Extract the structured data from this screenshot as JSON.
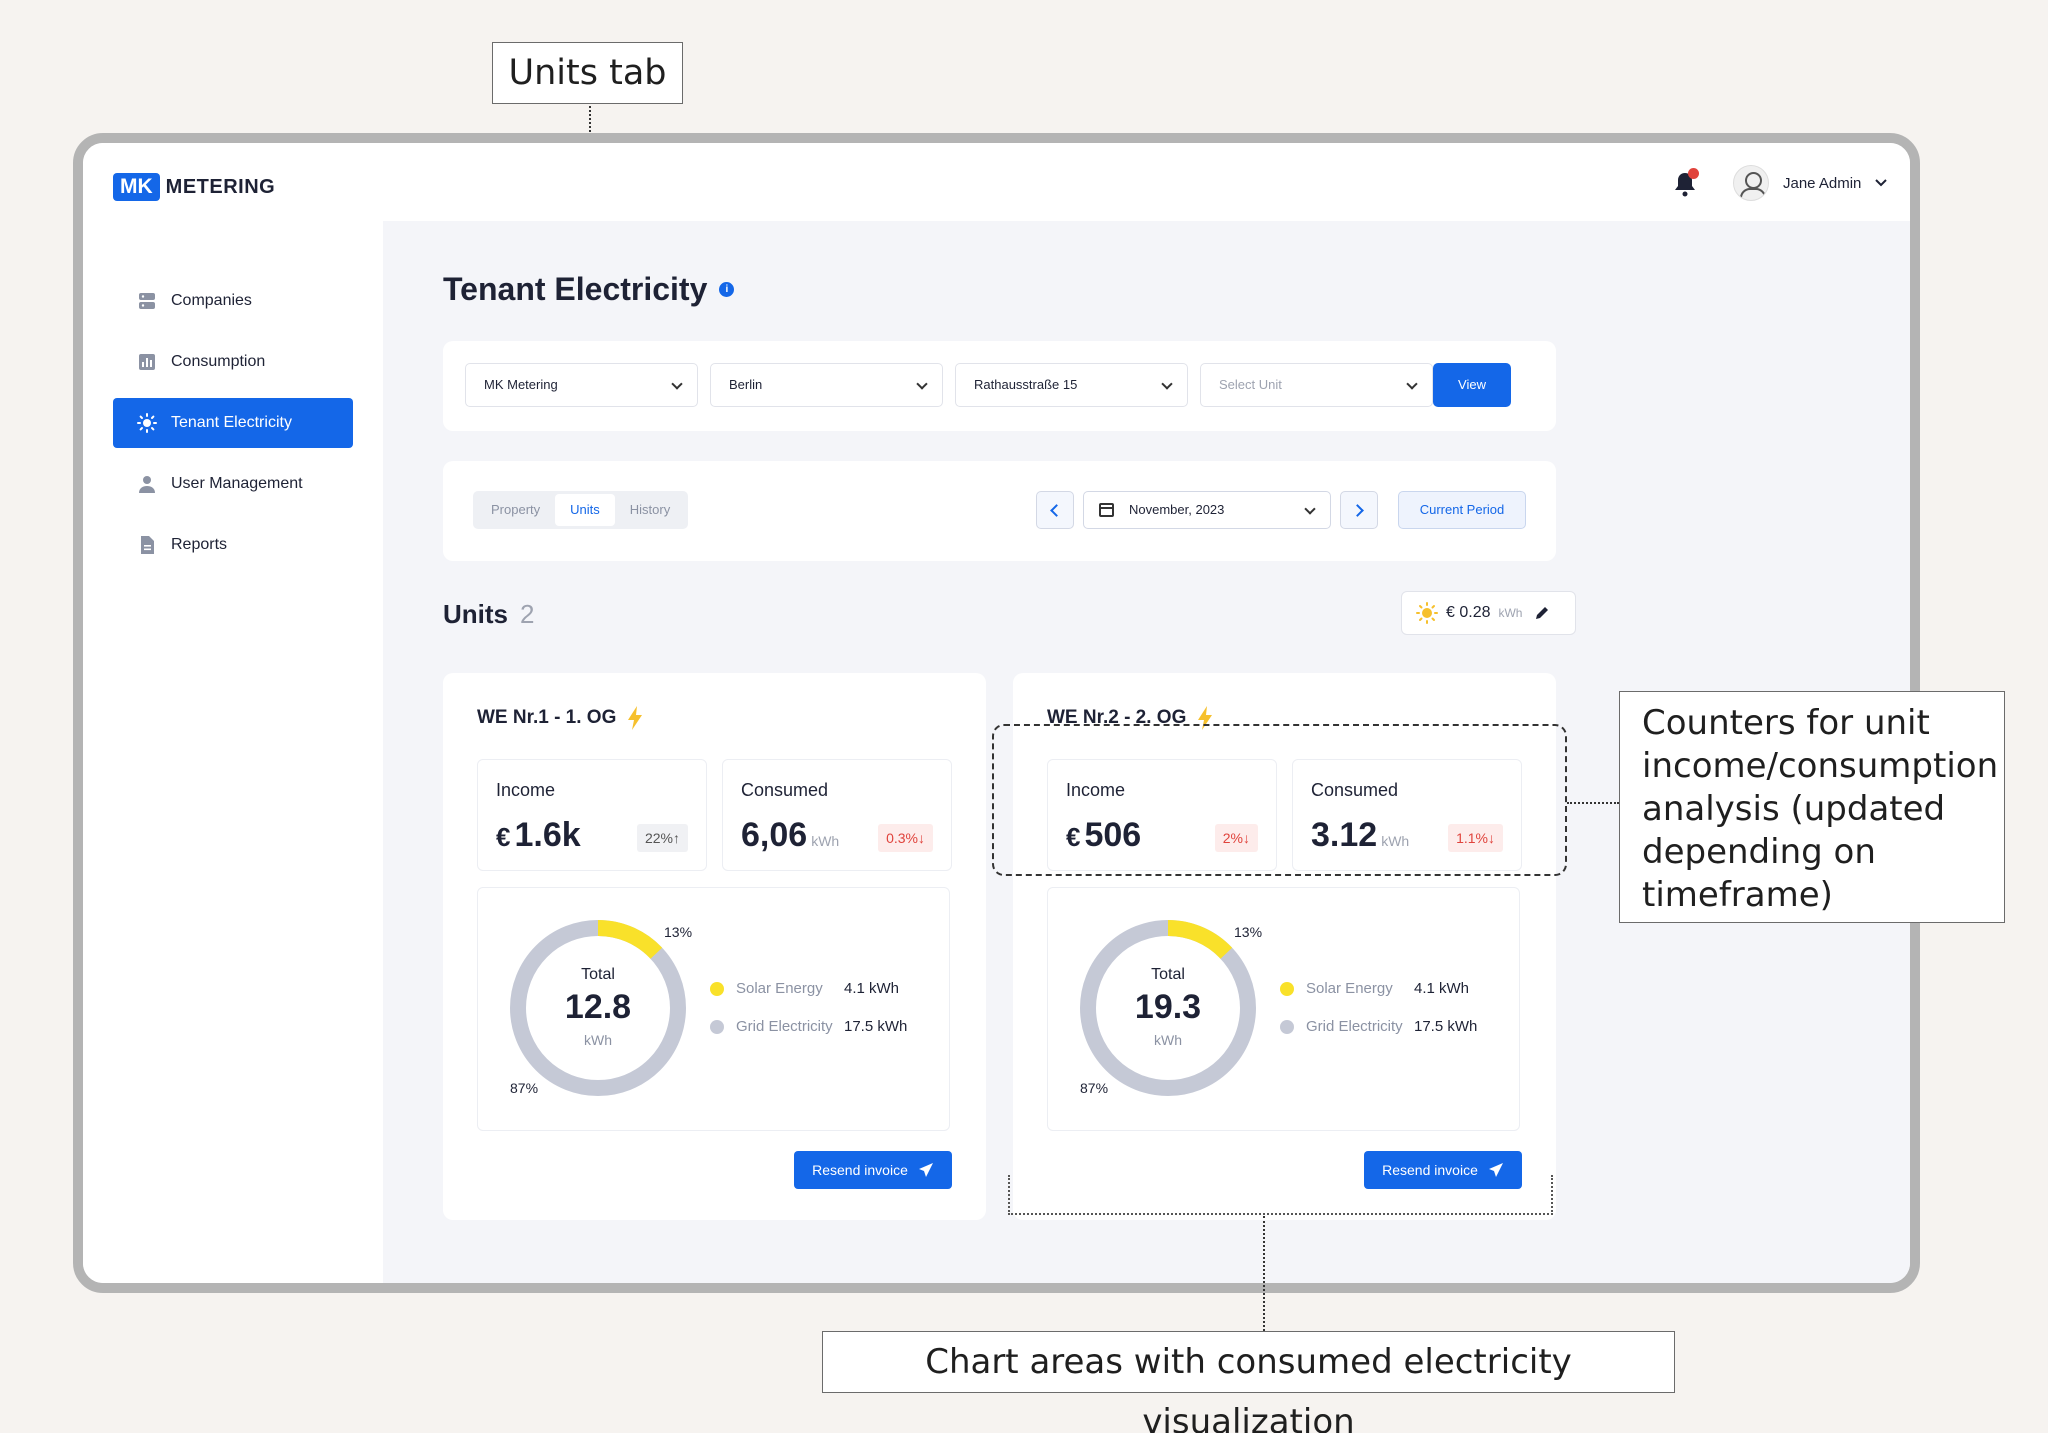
{
  "annotations": {
    "units_tab": "Units tab",
    "counters": "Counters for unit income/consumption analysis (updated depending on timeframe)",
    "charts": "Chart areas with consumed electricity visualization"
  },
  "header": {
    "logo_mk": "MK",
    "logo_text": "METERING",
    "user_name": "Jane Admin",
    "notification_color": "#e0433c"
  },
  "sidebar": {
    "items": [
      {
        "label": "Companies",
        "icon": "server-icon"
      },
      {
        "label": "Consumption",
        "icon": "bar-chart-icon"
      },
      {
        "label": "Tenant Electricity",
        "icon": "sun-icon",
        "active": true
      },
      {
        "label": "User Management",
        "icon": "user-icon"
      },
      {
        "label": "Reports",
        "icon": "document-icon"
      }
    ]
  },
  "page": {
    "title": "Tenant Electricity",
    "info_icon": "i"
  },
  "filters": {
    "company": "MK Metering",
    "city": "Berlin",
    "address": "Rathausstraße 15",
    "unit_placeholder": "Select Unit",
    "view_label": "View"
  },
  "tabs": {
    "items": [
      "Property",
      "Units",
      "History"
    ],
    "active": "Units",
    "period": "November, 2023",
    "current_period_label": "Current Period"
  },
  "units": {
    "heading": "Units",
    "count": "2",
    "price": "€ 0.28",
    "price_unit": "kWh"
  },
  "cards": [
    {
      "title": "WE Nr.1 - 1. OG",
      "income_label": "Income",
      "income_currency": "€",
      "income_value": "1.6k",
      "income_change": "22%↑",
      "consumed_label": "Consumed",
      "consumed_value": "6,06",
      "consumed_unit": "kWh",
      "consumed_change": "0.3%↓",
      "total_label": "Total",
      "total_value": "12.8",
      "total_unit": "kWh",
      "solar_pct": "13%",
      "grid_pct": "87%",
      "solar_label": "Solar Energy",
      "solar_value": "4.1 kWh",
      "grid_label": "Grid Electricity",
      "grid_value": "17.5 kWh",
      "resend_label": "Resend invoice"
    },
    {
      "title": "WE Nr.2 - 2. OG",
      "income_label": "Income",
      "income_currency": "€",
      "income_value": "506",
      "income_change": "2%↓",
      "consumed_label": "Consumed",
      "consumed_value": "3.12",
      "consumed_unit": "kWh",
      "consumed_change": "1.1%↓",
      "total_label": "Total",
      "total_value": "19.3",
      "total_unit": "kWh",
      "solar_pct": "13%",
      "grid_pct": "87%",
      "solar_label": "Solar Energy",
      "solar_value": "4.1 kWh",
      "grid_label": "Grid Electricity",
      "grid_value": "17.5 kWh",
      "resend_label": "Resend invoice"
    }
  ],
  "colors": {
    "accent": "#1467e8",
    "solar": "#f9e12a",
    "grid": "#c5c9d6",
    "negative": "#e0433c"
  }
}
